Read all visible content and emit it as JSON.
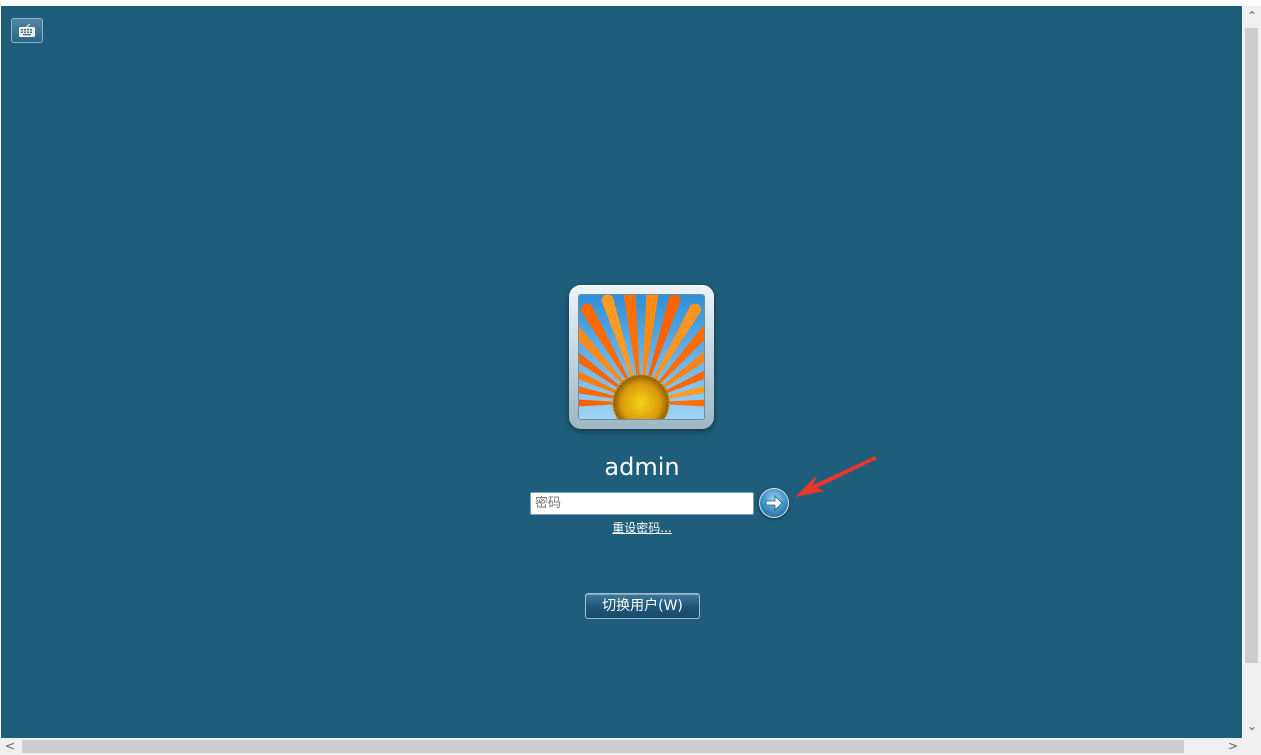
{
  "login": {
    "username": "admin",
    "password_placeholder": "密码",
    "reset_password_link": "重设密码...",
    "switch_user_button": "切换用户(W)"
  },
  "icons": {
    "keyboard": "on-screen-keyboard-icon",
    "submit": "arrow-right-icon",
    "avatar": "flower-avatar"
  },
  "colors": {
    "background": "#1f5e7a",
    "annotation_arrow": "#e8362e"
  }
}
